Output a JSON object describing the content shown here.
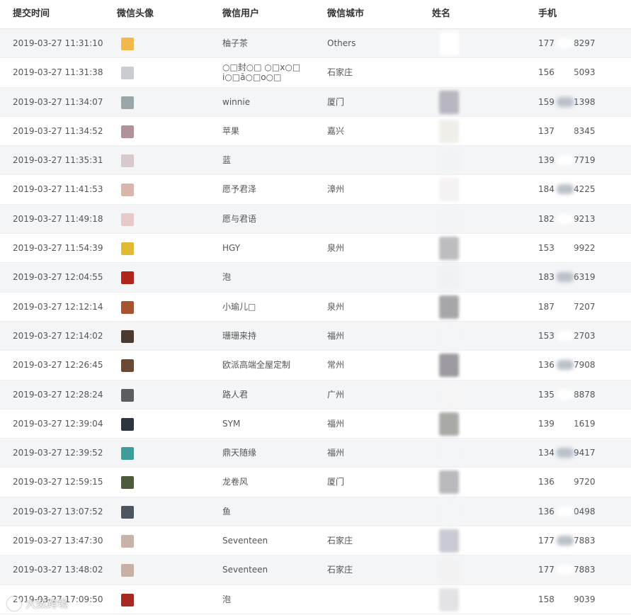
{
  "headers": {
    "time": "提交时间",
    "avatar": "微信头像",
    "user": "微信用户",
    "city": "微信城市",
    "name": "姓名",
    "phone": "手机"
  },
  "rows": [
    {
      "time": "2019-03-27 11:31:10",
      "avatar_color": "#f2b84b",
      "user": "柚子茶",
      "city": "Others",
      "name_color": "#ffffff",
      "phone_pre": "177",
      "phone_suf": "8297"
    },
    {
      "time": "2019-03-27 11:31:38",
      "avatar_color": "#c9cdd1",
      "user": "○□封○□ ○□x○□",
      "user2": "i○□ā○□o○□",
      "city": "石家庄",
      "name_color": "#ffffff",
      "phone_pre": "156",
      "phone_suf": "5093"
    },
    {
      "time": "2019-03-27 11:34:07",
      "avatar_color": "#9aa7a8",
      "user": "winnie",
      "city": "厦门",
      "name_color": "#b8b6c1",
      "phone_pre": "159",
      "phone_suf": "1398"
    },
    {
      "time": "2019-03-27 11:34:52",
      "avatar_color": "#b2929a",
      "user": "苹果",
      "city": "嘉兴",
      "name_color": "#efeee8",
      "phone_pre": "137",
      "phone_suf": "8345"
    },
    {
      "time": "2019-03-27 11:35:31",
      "avatar_color": "#d8c9cc",
      "user": "蓝",
      "city": "",
      "name_color": "#f1f3f6",
      "phone_pre": "139",
      "phone_suf": "7719"
    },
    {
      "time": "2019-03-27 11:41:53",
      "avatar_color": "#d9b6ac",
      "user": "愿予君泽",
      "city": "漳州",
      "name_color": "#f4f2f2",
      "phone_pre": "184",
      "phone_suf": "4225"
    },
    {
      "time": "2019-03-27 11:49:18",
      "avatar_color": "#e8c9c9",
      "user": "愿与君语",
      "city": "",
      "name_color": "#f3f4f5",
      "phone_pre": "182",
      "phone_suf": "9213"
    },
    {
      "time": "2019-03-27 11:54:39",
      "avatar_color": "#e0b935",
      "user": "HGY",
      "city": "泉州",
      "name_color": "#bdbdc0",
      "phone_pre": "153",
      "phone_suf": "9922"
    },
    {
      "time": "2019-03-27 12:04:55",
      "avatar_color": "#b0241c",
      "user": "泡",
      "city": "",
      "name_color": "#f0f1f2",
      "phone_pre": "183",
      "phone_suf": "6319"
    },
    {
      "time": "2019-03-27 12:12:14",
      "avatar_color": "#a85330",
      "user": "小瑜儿□",
      "city": "泉州",
      "name_color": "#a6a6a9",
      "phone_pre": "187",
      "phone_suf": "7207"
    },
    {
      "time": "2019-03-27 12:14:02",
      "avatar_color": "#4a3a30",
      "user": "珊珊来持",
      "city": "福州",
      "name_color": "#f4f5f6",
      "phone_pre": "153",
      "phone_suf": "2703"
    },
    {
      "time": "2019-03-27 12:26:45",
      "avatar_color": "#6a4a34",
      "user": "欧派高端全屋定制",
      "city": "常州",
      "name_color": "#9c9aa0",
      "phone_pre": "136",
      "phone_suf": "7908"
    },
    {
      "time": "2019-03-27 12:28:24",
      "avatar_color": "#5b5d60",
      "user": "路人君",
      "city": "广州",
      "name_color": "#f5f5f6",
      "phone_pre": "135",
      "phone_suf": "8878"
    },
    {
      "time": "2019-03-27 12:39:04",
      "avatar_color": "#2d3640",
      "user": "SYM",
      "city": "福州",
      "name_color": "#a9aaa6",
      "phone_pre": "139",
      "phone_suf": "1619"
    },
    {
      "time": "2019-03-27 12:39:52",
      "avatar_color": "#3e9c9a",
      "user": "鼎天随缘",
      "city": "福州",
      "name_color": "#f4f5f6",
      "phone_pre": "134",
      "phone_suf": "9417"
    },
    {
      "time": "2019-03-27 12:59:15",
      "avatar_color": "#4e5a3c",
      "user": "龙卷风",
      "city": "厦门",
      "name_color": "#b8b8bd",
      "phone_pre": "136",
      "phone_suf": "9720"
    },
    {
      "time": "2019-03-27 13:07:52",
      "avatar_color": "#4c5660",
      "user": "鱼",
      "city": "",
      "name_color": "#f4f5f6",
      "phone_pre": "136",
      "phone_suf": "0498"
    },
    {
      "time": "2019-03-27 13:47:30",
      "avatar_color": "#c7b3a8",
      "user": "Seventeen",
      "city": "石家庄",
      "name_color": "#c9cad3",
      "phone_pre": "177",
      "phone_suf": "7883"
    },
    {
      "time": "2019-03-27 13:48:02",
      "avatar_color": "#c8b0a3",
      "user": "Seventeen",
      "city": "石家庄",
      "name_color": "#f2f2f3",
      "phone_pre": "177",
      "phone_suf": "7883"
    },
    {
      "time": "2019-03-27 17:09:50",
      "avatar_color": "#a82920",
      "user": "泡",
      "city": "",
      "name_color": "#e3e3e6",
      "phone_pre": "158",
      "phone_suf": "9039"
    }
  ],
  "watermark": "大数跨境"
}
